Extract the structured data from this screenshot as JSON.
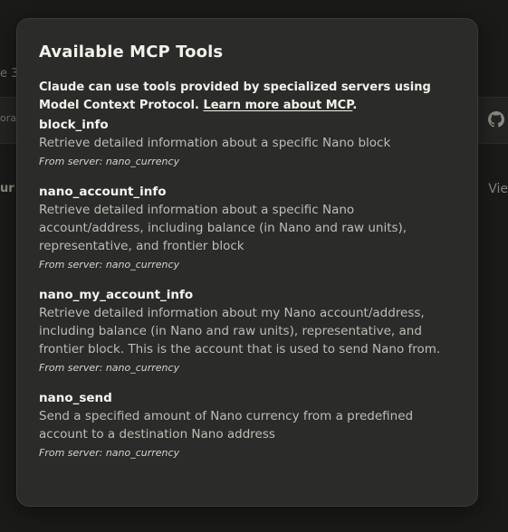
{
  "background": {
    "left_fragment_1": "e 3",
    "left_fragment_2": "ora",
    "left_fragment_3": "ur r",
    "right_fragment": "Vie"
  },
  "dialog": {
    "title": "Available MCP Tools",
    "intro_text": "Claude can use tools provided by specialized servers using Model Context Protocol.",
    "learn_more_link": "Learn more about MCP",
    "intro_period": "."
  },
  "tools": [
    {
      "name": "block_info",
      "description": "Retrieve detailed information about a specific Nano block",
      "server": "From server: nano_currency"
    },
    {
      "name": "nano_account_info",
      "description": "Retrieve detailed information about a specific Nano account/address, including balance (in Nano and raw units), representative, and frontier block",
      "server": "From server: nano_currency"
    },
    {
      "name": "nano_my_account_info",
      "description": "Retrieve detailed information about my Nano account/address, including balance (in Nano and raw units), representative, and frontier block. This is the account that is used to send Nano from.",
      "server": "From server: nano_currency"
    },
    {
      "name": "nano_send",
      "description": "Send a specified amount of Nano currency from a predefined account to a destination Nano address",
      "server": "From server: nano_currency"
    }
  ],
  "icons": {
    "github": "github-icon"
  }
}
